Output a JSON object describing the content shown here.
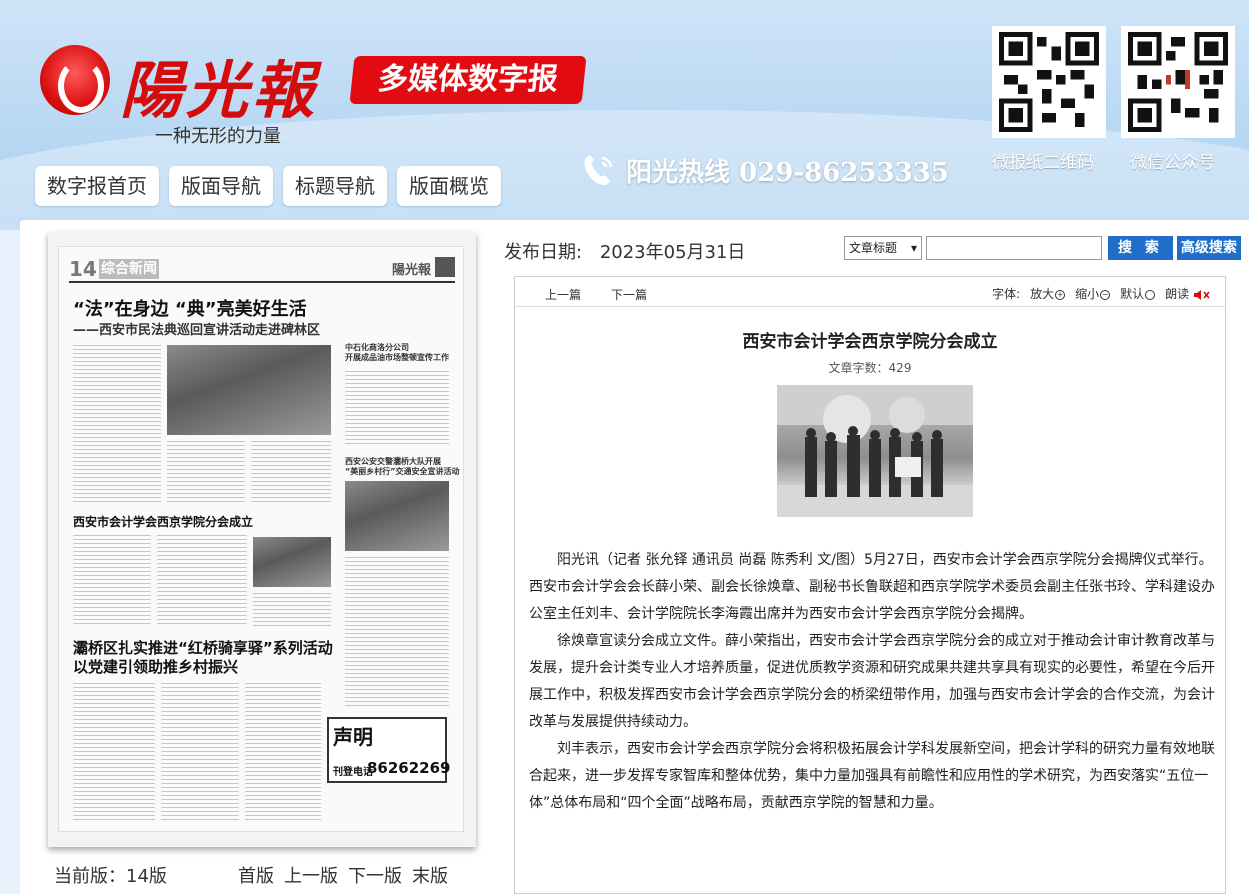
{
  "header": {
    "logo_text": "陽光報",
    "slogan": "一种无形的力量",
    "badge": "多媒体数字报",
    "hotline": "阳光热线 029-86253335",
    "nav": [
      "数字报首页",
      "版面导航",
      "标题导航",
      "版面概览"
    ],
    "qr_labels": [
      "微报纸二维码",
      "微信公众号"
    ]
  },
  "paper": {
    "page_no": "14",
    "section": "综合新闻",
    "mini_logo": "陽光報",
    "headline1": "“法”在身边 “典”亮美好生活",
    "headline2": "——西安市民法典巡回宣讲活动走进碑林区",
    "headline3": "西安市会计学会西京学院分会成立",
    "headline4_line1": "灞桥区扎实推进“红桥骑享驿”系列活动",
    "headline4_line2": "以党建引领助推乡村振兴",
    "side1_line1": "中石化商洛分公司",
    "side1_line2": "开展成品油市场整顿宣传工作",
    "side2_line1": "西安公安交警灞桥大队开展",
    "side2_line2": "“美丽乡村行”交通安全宣讲活动",
    "notice_title": "声明",
    "notice_label": "刊登电话",
    "notice_phone": "86262269"
  },
  "pager": {
    "current": "当前版：14版",
    "links": [
      "首版",
      "上一版",
      "下一版",
      "末版"
    ]
  },
  "pubdate": {
    "label": "发布日期:",
    "value": "2023年05月31日"
  },
  "search": {
    "select_value": "文章标题",
    "button": "搜 索",
    "advanced": "高级搜索"
  },
  "toolbar": {
    "prev": "上一篇",
    "next": "下一篇",
    "font_label": "字体:",
    "enlarge": "放大",
    "shrink": "缩小",
    "default": "默认",
    "read": "朗读"
  },
  "article": {
    "title": "西安市会计学会西京学院分会成立",
    "wordcount": "文章字数：429",
    "paragraphs": [
      "阳光讯（记者 张允铎 通讯员 尚磊 陈秀利 文/图）5月27日，西安市会计学会西京学院分会揭牌仪式举行。西安市会计学会会长薛小荣、副会长徐焕章、副秘书长鲁联超和西京学院学术委员会副主任张书玲、学科建设办公室主任刘丰、会计学院院长李海霞出席并为西安市会计学会西京学院分会揭牌。",
      "徐焕章宣读分会成立文件。薛小荣指出，西安市会计学会西京学院分会的成立对于推动会计审计教育改革与发展，提升会计类专业人才培养质量，促进优质教学资源和研究成果共建共享具有现实的必要性，希望在今后开展工作中，积极发挥西安市会计学会西京学院分会的桥梁纽带作用，加强与西安市会计学会的合作交流，为会计改革与发展提供持续动力。",
      "刘丰表示，西安市会计学会西京学院分会将积极拓展会计学科发展新空间，把会计学科的研究力量有效地联合起来，进一步发挥专家智库和整体优势，集中力量加强具有前瞻性和应用性的学术研究，为西安落实“五位一体”总体布局和“四个全面”战略布局，贡献西京学院的智慧和力量。"
    ]
  },
  "colors": {
    "brand_red": "#e30b12",
    "accent_blue": "#1f6fc9"
  }
}
